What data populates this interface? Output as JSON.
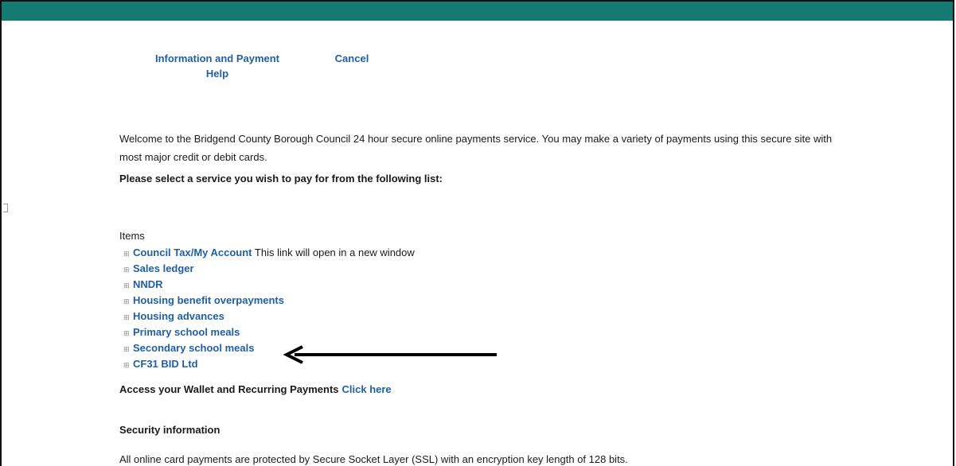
{
  "nav": {
    "info_line1": "Information and Payment",
    "info_line2": "Help",
    "cancel": "Cancel"
  },
  "intro": {
    "welcome": "Welcome to the Bridgend County Borough Council 24 hour secure online payments service. You may make a variety of payments using this secure site with most major credit or debit cards.",
    "prompt": "Please select a service you wish to pay for from the following list:"
  },
  "items": {
    "heading": "Items",
    "list": [
      {
        "label": "Council Tax/My Account",
        "note": "This link will open in a new window"
      },
      {
        "label": "Sales ledger",
        "note": ""
      },
      {
        "label": "NNDR",
        "note": ""
      },
      {
        "label": "Housing benefit overpayments",
        "note": ""
      },
      {
        "label": "Housing advances",
        "note": ""
      },
      {
        "label": "Primary school meals",
        "note": ""
      },
      {
        "label": "Secondary school meals",
        "note": ""
      },
      {
        "label": "CF31 BID Ltd",
        "note": ""
      }
    ]
  },
  "wallet": {
    "text": "Access your Wallet and Recurring Payments",
    "link": "Click here"
  },
  "security": {
    "heading": "Security information",
    "text": "All online card payments are protected by Secure Socket Layer (SSL) with an encryption key length of 128 bits."
  },
  "colors": {
    "topbar": "#147a72",
    "link": "#1f5fa4",
    "arrow": "#000000"
  },
  "annotation": {
    "arrow_points_to": "Secondary school meals"
  }
}
